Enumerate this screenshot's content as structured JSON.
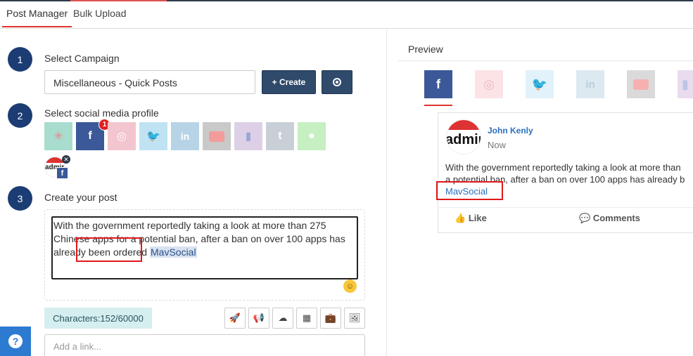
{
  "tabs": [
    {
      "label": "Post Manager",
      "active": true
    },
    {
      "label": "Bulk Upload",
      "active": false
    }
  ],
  "steps": {
    "one": {
      "number": "1",
      "label": "Select Campaign"
    },
    "two": {
      "number": "2",
      "label": "Select social media profile"
    },
    "three": {
      "number": "3",
      "label": "Create your post"
    }
  },
  "campaign": {
    "selected": "Miscellaneous - Quick Posts",
    "create_label": "+ Create"
  },
  "profiles": {
    "facebook_badge": "1",
    "icons": [
      "spark-icon",
      "facebook-icon",
      "instagram-icon",
      "twitter-icon",
      "linkedin-icon",
      "youtube-icon",
      "google-business-icon",
      "tumblr-icon",
      "wechat-icon"
    ],
    "selected_avatar_text": "admir"
  },
  "post": {
    "text": "With the government reportedly taking a look at more than 275 Chinese apps for a potential ban, after a ban on over 100 apps has already been ordered ",
    "tag": "MavSocial",
    "characters": "Characters:152/60000",
    "link_placeholder": "Add a link..."
  },
  "preview": {
    "title": "Preview",
    "name": "John Kenly",
    "time": "Now",
    "avatar_text": "admir",
    "text_line1": "With the government reportedly taking a look at more than",
    "text_line2": "a potential ban, after a ban on over 100 apps has already b",
    "tag": "MavSocial",
    "like": "Like",
    "comments": "Comments"
  },
  "colors": {
    "primary": "#1b3d73",
    "accent_red": "#e0342c",
    "facebook": "#3b5998"
  }
}
